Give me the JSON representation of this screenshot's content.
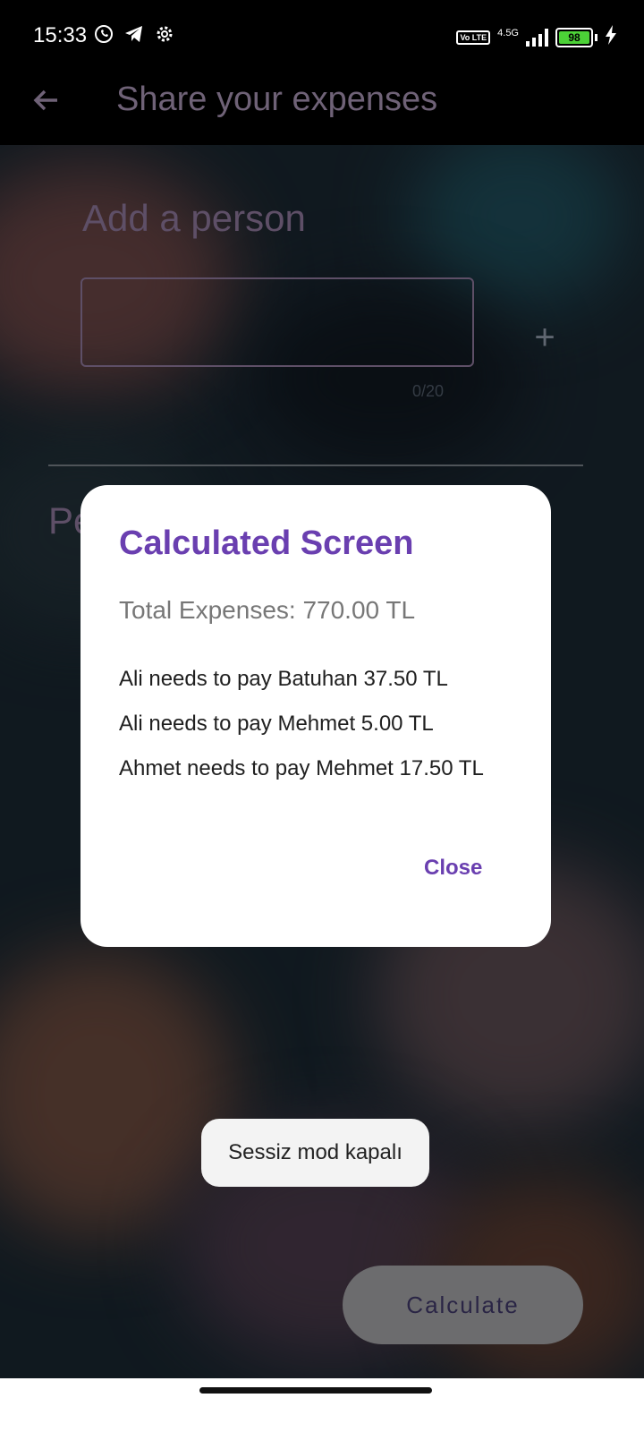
{
  "status_bar": {
    "time": "15:33",
    "network": "4.5G",
    "volte": "Vo LTE",
    "battery": "98",
    "icons": [
      "whatsapp-icon",
      "telegram-icon",
      "settings-icon",
      "signal-icon",
      "battery-icon",
      "charging-icon"
    ]
  },
  "app_bar": {
    "title": "Share your expenses",
    "back_icon": "arrow-left-icon"
  },
  "form": {
    "heading": "Add a person",
    "name_value": "",
    "counter": "0/20",
    "add_icon": "plus-icon",
    "section_heading_partial": "Pe"
  },
  "dialog": {
    "title": "Calculated Screen",
    "total": "Total Expenses: 770.00 TL",
    "lines": [
      "Ali needs to pay Batuhan 37.50 TL",
      "Ali needs to pay Mehmet 5.00 TL",
      "Ahmet needs to pay Mehmet 17.50 TL"
    ],
    "close_label": "Close"
  },
  "toast": {
    "text": "Sessiz mod kapalı"
  },
  "fab": {
    "label": "Calculate"
  },
  "colors": {
    "accent": "#6a3fb0",
    "muted_purple": "#5e4f67",
    "battery_green": "#4cd137"
  }
}
